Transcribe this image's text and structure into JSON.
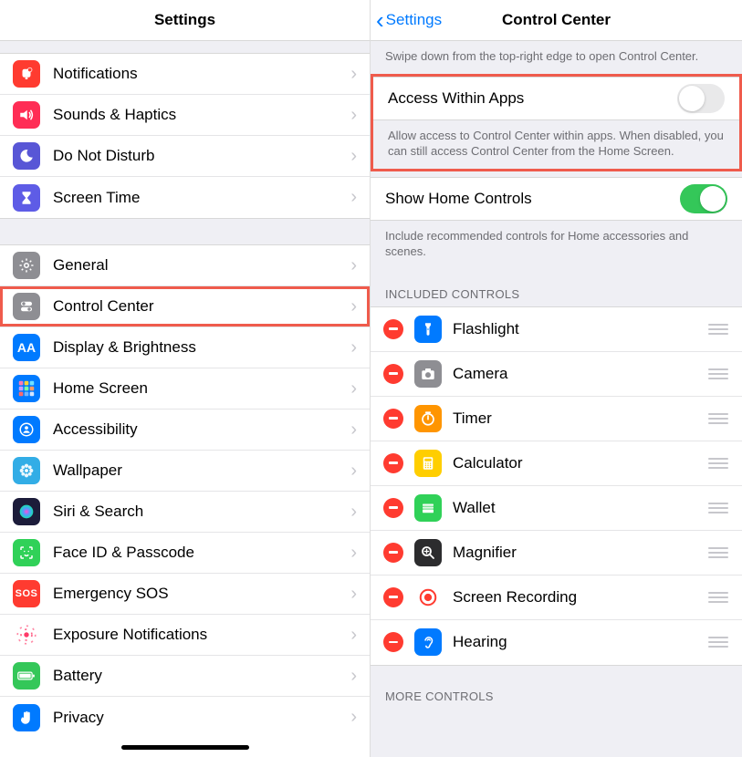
{
  "left": {
    "title": "Settings",
    "group1": [
      {
        "label": "Notifications",
        "icon": "bell",
        "color": "bg-red"
      },
      {
        "label": "Sounds & Haptics",
        "icon": "speaker",
        "color": "bg-pink"
      },
      {
        "label": "Do Not Disturb",
        "icon": "moon",
        "color": "bg-purple"
      },
      {
        "label": "Screen Time",
        "icon": "hourglass",
        "color": "bg-violet"
      }
    ],
    "group2": [
      {
        "label": "General",
        "icon": "gear",
        "color": "bg-gray"
      },
      {
        "label": "Control Center",
        "icon": "switches",
        "color": "bg-gray",
        "highlight": true
      },
      {
        "label": "Display & Brightness",
        "icon": "aa",
        "color": "bg-blue"
      },
      {
        "label": "Home Screen",
        "icon": "grid",
        "color": "bg-multi"
      },
      {
        "label": "Accessibility",
        "icon": "person",
        "color": "bg-blue"
      },
      {
        "label": "Wallpaper",
        "icon": "flower",
        "color": "bg-cyan"
      },
      {
        "label": "Siri & Search",
        "icon": "siri",
        "color": "bg-navy"
      },
      {
        "label": "Face ID & Passcode",
        "icon": "face",
        "color": "bg-face"
      },
      {
        "label": "Emergency SOS",
        "icon": "sos",
        "color": "bg-red"
      },
      {
        "label": "Exposure Notifications",
        "icon": "expo",
        "color": "bg-expo"
      },
      {
        "label": "Battery",
        "icon": "battery",
        "color": "bg-green"
      },
      {
        "label": "Privacy",
        "icon": "hand",
        "color": "bg-blue"
      }
    ]
  },
  "right": {
    "back_label": "Settings",
    "title": "Control Center",
    "intro": "Swipe down from the top-right edge to open Control Center.",
    "access_label": "Access Within Apps",
    "access_on": false,
    "access_desc": "Allow access to Control Center within apps. When disabled, you can still access Control Center from the Home Screen.",
    "home_label": "Show Home Controls",
    "home_on": true,
    "home_desc": "Include recommended controls for Home accessories and scenes.",
    "included_header": "INCLUDED CONTROLS",
    "included": [
      {
        "label": "Flashlight",
        "icon": "flashlight",
        "color": "bg-blue"
      },
      {
        "label": "Camera",
        "icon": "camera",
        "color": "bg-gray"
      },
      {
        "label": "Timer",
        "icon": "timer",
        "color": "bg-orange"
      },
      {
        "label": "Calculator",
        "icon": "calc",
        "color": "bg-yellow"
      },
      {
        "label": "Wallet",
        "icon": "wallet",
        "color": "bg-greenlight"
      },
      {
        "label": "Magnifier",
        "icon": "magnifier",
        "color": "bg-dark"
      },
      {
        "label": "Screen Recording",
        "icon": "record",
        "color": "bg-redcircle"
      },
      {
        "label": "Hearing",
        "icon": "ear",
        "color": "bg-blue"
      }
    ],
    "more_header": "MORE CONTROLS"
  }
}
